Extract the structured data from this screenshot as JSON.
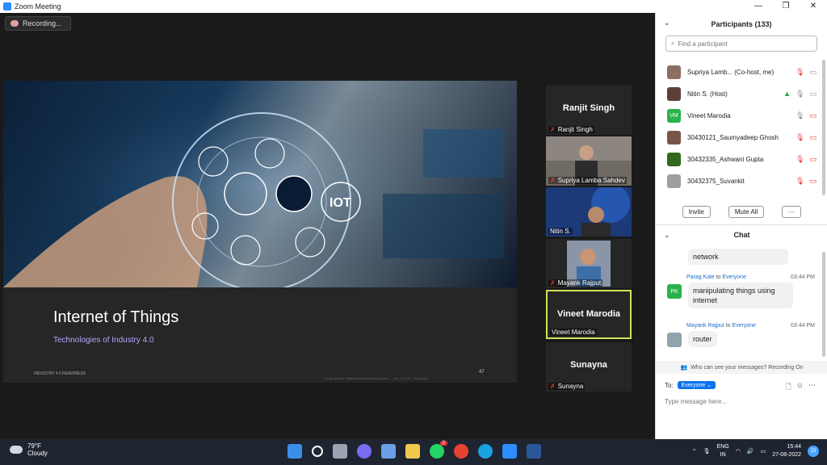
{
  "window": {
    "title": "Zoom Meeting"
  },
  "recording": {
    "label": "Recording..."
  },
  "slide": {
    "title": "Internet of Things",
    "subtitle": "Technologies of Industry 4.0",
    "footer": "INDUSTRY 4.0 READINESS",
    "page_number": "47",
    "source": "Image source: https://www.shutterstock.com/..._Top_10_IoT_Trends.jpg",
    "iot_label": "IOT"
  },
  "gallery": [
    {
      "display_name": "Ranjit Singh",
      "label": "Ranjit Singh",
      "muted": true
    },
    {
      "display_name": "",
      "label": "Supriya Lamba  Sahdev",
      "muted": true
    },
    {
      "display_name": "",
      "label": "Nitin S.",
      "muted": false
    },
    {
      "display_name": "",
      "label": "Mayank Rajput",
      "muted": true
    },
    {
      "display_name": "Vineet Marodia",
      "label": "Vineet Marodia",
      "muted": false,
      "active": true
    },
    {
      "display_name": "Sunayna",
      "label": "Sunayna",
      "muted": true
    }
  ],
  "participants": {
    "header": "Participants (133)",
    "search_placeholder": "Find a participant",
    "list": [
      {
        "name": "Supriya Lamb...",
        "role": "(Co-host, me)",
        "color": "#8d6e63"
      },
      {
        "name": "Nitin S.",
        "role": "(Host)",
        "color": "#5d4037"
      },
      {
        "name": "Vineet Marodia",
        "role": "",
        "color": "#2bb24c",
        "initials": "VM"
      },
      {
        "name": "30430121_Saumyadeep Ghosh",
        "role": "",
        "color": "#795548"
      },
      {
        "name": "30432335_Ashwani Gupta",
        "role": "",
        "color": "#33691e"
      },
      {
        "name": "30432375_Suvankit",
        "role": "",
        "color": "#9e9e9e"
      }
    ],
    "invite_label": "Invite",
    "mute_all_label": "Mute All",
    "more_label": "···"
  },
  "chat": {
    "header": "Chat",
    "messages": [
      {
        "sender": "",
        "to": "",
        "time": "",
        "text": "network"
      },
      {
        "sender": "Parag Kale",
        "to": "Everyone",
        "time": "03:44 PM",
        "text": "manipulating things using internet",
        "initials": "PK"
      },
      {
        "sender": "Mayank Rajput",
        "to": "Everyone",
        "time": "03:44 PM",
        "text": "router"
      }
    ],
    "to_word": "to",
    "notice": "Who can see your messages? Recording On",
    "to_label": "To:",
    "recipient": "Everyone",
    "input_placeholder": "Type message here..."
  },
  "taskbar": {
    "temperature": "79°F",
    "condition": "Cloudy",
    "lang_top": "ENG",
    "lang_bottom": "IN",
    "time": "15:44",
    "date": "27-08-2022",
    "notifications": "23",
    "whatsapp_badge": "2"
  }
}
